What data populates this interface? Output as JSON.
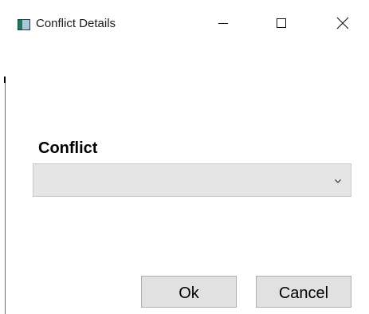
{
  "window": {
    "title": "Conflict Details",
    "icon": "app-window-icon",
    "controls": {
      "minimize_icon": "minimize-icon",
      "maximize_icon": "maximize-icon",
      "close_icon": "close-icon"
    }
  },
  "form": {
    "conflict_label": "Conflict",
    "conflict_value": "",
    "dropdown_icon": "chevron-down-icon"
  },
  "buttons": {
    "ok_label": "Ok",
    "cancel_label": "Cancel"
  },
  "colors": {
    "combo_background": "#e5e5e5",
    "button_background": "#e1e1e1",
    "button_border": "#adadad"
  }
}
